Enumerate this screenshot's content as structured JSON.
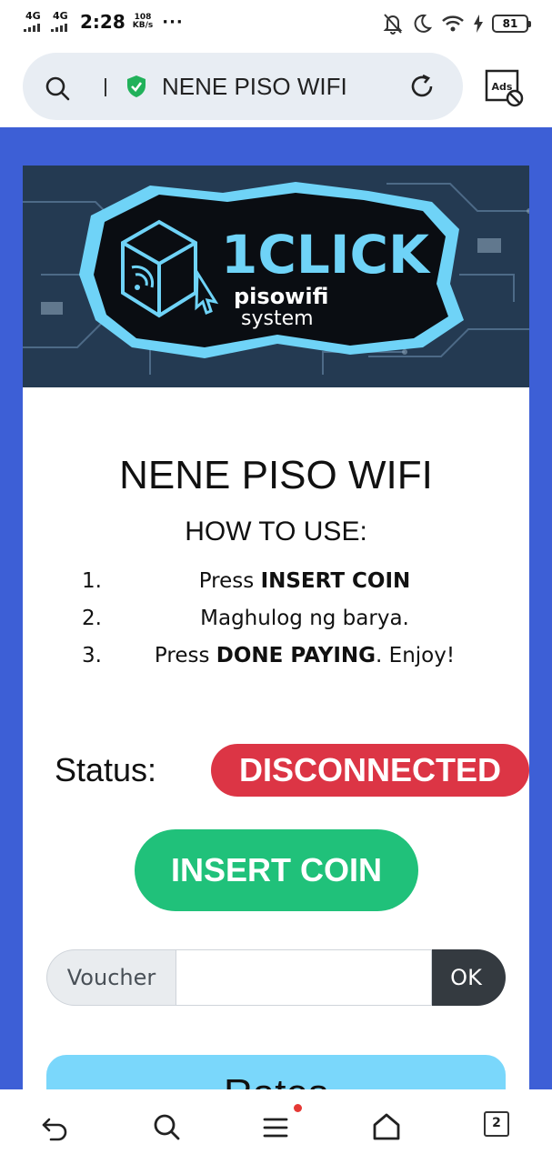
{
  "status_bar": {
    "network_1": "4G",
    "network_2": "4G",
    "time": "2:28",
    "speed_value": "108",
    "speed_unit": "KB/s",
    "more": "···",
    "battery": "81"
  },
  "address_bar": {
    "url_text": "NENE PISO WIFI",
    "ads_label": "Ads"
  },
  "banner": {
    "logo_big": "1CLICK",
    "logo_sub1": "pisowifi",
    "logo_sub2": "system"
  },
  "page": {
    "title": "NENE PISO WIFI",
    "how_to_use": "HOW TO USE:",
    "steps": [
      {
        "num": "1.",
        "pre": "Press ",
        "bold": "INSERT COIN",
        "post": ""
      },
      {
        "num": "2.",
        "pre": "Maghulog ng barya.",
        "bold": "",
        "post": ""
      },
      {
        "num": "3.",
        "pre": "Press ",
        "bold": "DONE PAYING",
        "post": ". Enjoy!"
      }
    ],
    "status_label": "Status:",
    "status_value": "DISCONNECTED",
    "insert_coin": "INSERT COIN",
    "voucher_label": "Voucher",
    "voucher_value": "",
    "voucher_ok": "OK",
    "rates_title": "Rates"
  },
  "bottom_nav": {
    "tabs_count": "2"
  },
  "colors": {
    "page_bg": "#3d5fd6",
    "status_badge": "#dc3545",
    "insert_button": "#20c17a",
    "rates_bg": "#7ad7fb",
    "ok_button": "#343a40"
  }
}
